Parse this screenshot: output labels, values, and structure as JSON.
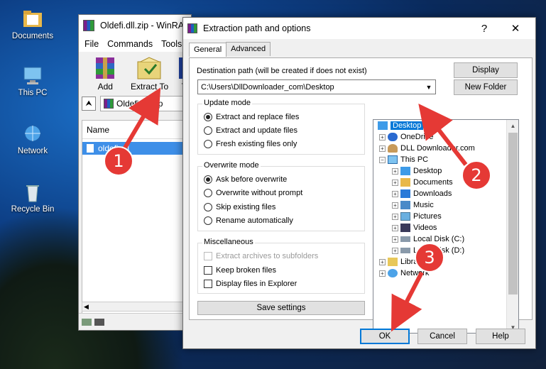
{
  "desktop": {
    "icons": [
      {
        "label": "Documents"
      },
      {
        "label": "This PC"
      },
      {
        "label": "Network"
      },
      {
        "label": "Recycle Bin"
      }
    ]
  },
  "winrar": {
    "title": "Oldefi.dll.zip - WinRAR",
    "menu": [
      "File",
      "Commands",
      "Tools"
    ],
    "toolbar": {
      "add": "Add",
      "extract_to": "Extract To",
      "more": "T"
    },
    "path": "Oldefi.dll.zip",
    "column_name": "Name",
    "file_row": "oldefi.dll"
  },
  "dialog": {
    "title": "Extraction path and options",
    "help_glyph": "?",
    "close_glyph": "✕",
    "tabs": [
      "General",
      "Advanced"
    ],
    "dest_label": "Destination path (will be created if does not exist)",
    "dest_value": "C:\\Users\\DllDownloader_com\\Desktop",
    "display_btn": "Display",
    "new_folder_btn": "New Folder",
    "update_mode": {
      "title": "Update mode",
      "options": [
        "Extract and replace files",
        "Extract and update files",
        "Fresh existing files only"
      ],
      "selected": 0
    },
    "overwrite_mode": {
      "title": "Overwrite mode",
      "options": [
        "Ask before overwrite",
        "Overwrite without prompt",
        "Skip existing files",
        "Rename automatically"
      ],
      "selected": 0
    },
    "misc": {
      "title": "Miscellaneous",
      "options": [
        "Extract archives to subfolders",
        "Keep broken files",
        "Display files in Explorer"
      ]
    },
    "save_settings": "Save settings",
    "tree": [
      "Desktop",
      "OneDrive",
      "DLL Downloader.com",
      "This PC",
      "Desktop",
      "Documents",
      "Downloads",
      "Music",
      "Pictures",
      "Videos",
      "Local Disk (C:)",
      "Local Disk (D:)",
      "Libraries",
      "Network"
    ],
    "ok": "OK",
    "cancel": "Cancel",
    "help": "Help"
  },
  "annotations": {
    "step1": "1",
    "step2": "2",
    "step3": "3"
  },
  "colors": {
    "accent": "#0078d7",
    "badge": "#e53935",
    "selection": "#3e8fe8"
  }
}
